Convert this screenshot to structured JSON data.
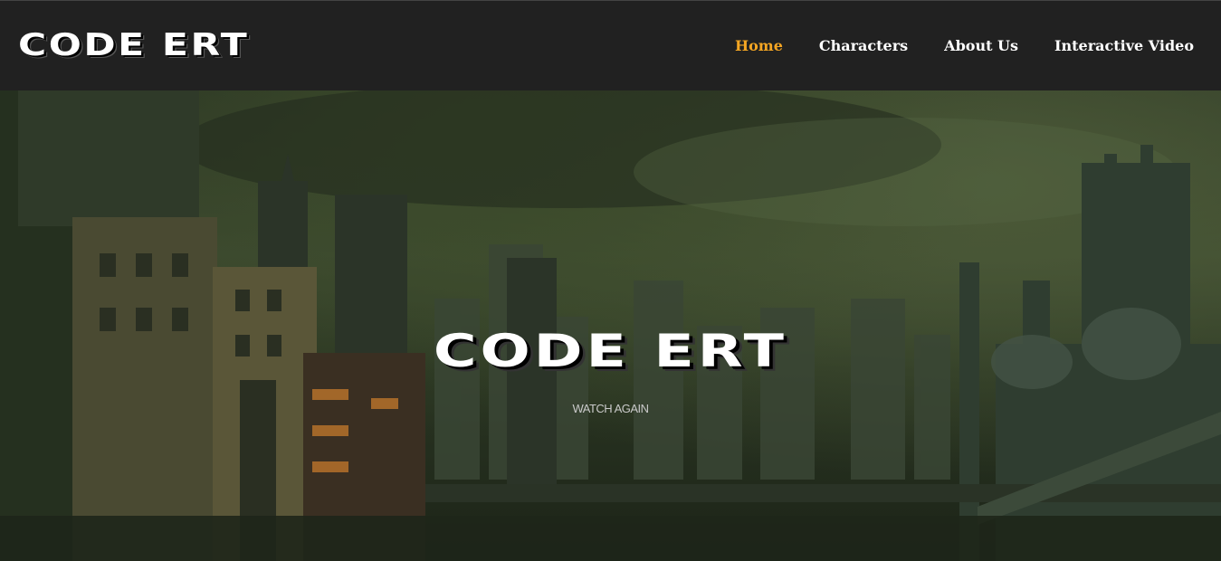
{
  "brand": {
    "logo_text": "CODE ERT"
  },
  "nav": {
    "items": [
      {
        "label": "Home",
        "active": true
      },
      {
        "label": "Characters",
        "active": false
      },
      {
        "label": "About Us",
        "active": false
      },
      {
        "label": "Interactive Video",
        "active": false
      }
    ]
  },
  "hero": {
    "title": "CODE ERT",
    "action_label": "WATCH AGAIN"
  },
  "colors": {
    "navbar_bg": "#212121",
    "active_link": "#f5a623",
    "link": "#ffffff"
  }
}
